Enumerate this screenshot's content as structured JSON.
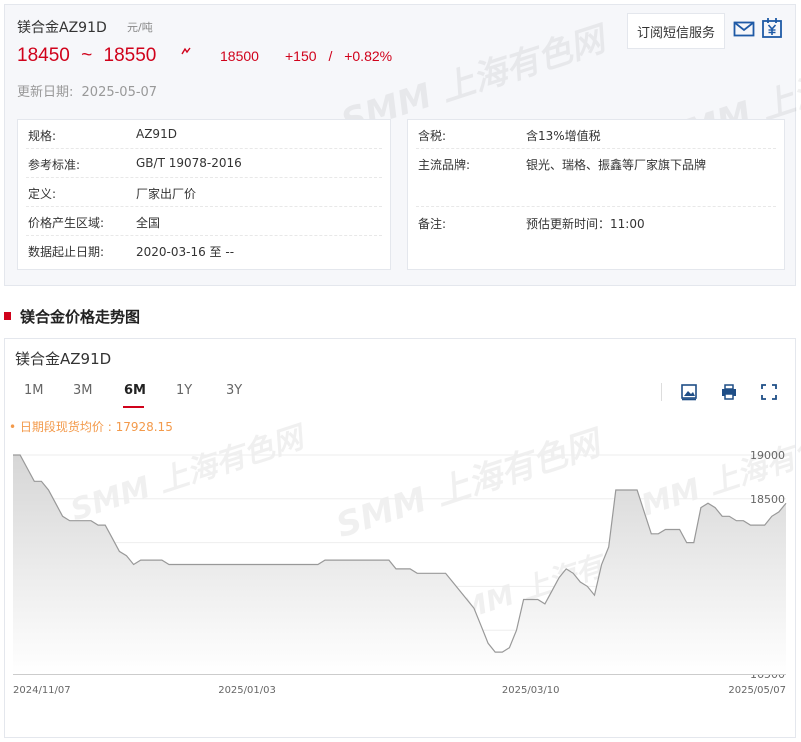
{
  "product": {
    "name": "镁合金AZ91D",
    "unit": "元/吨",
    "price_low": "18450",
    "price_tilde": "~",
    "price_high": "18550",
    "avg": "18500",
    "change": "+150",
    "change_sep": "/",
    "change_pct": "+0.82%",
    "update_label": "更新日期:",
    "update_date": "2025-05-07",
    "subscribe_label": "订阅短信服务"
  },
  "icons": {
    "mail": "mail-icon",
    "price": "yuan-calendar-icon",
    "trend": "trend-up-icon"
  },
  "info_left": [
    {
      "k": "规格:",
      "v": "AZ91D"
    },
    {
      "k": "参考标准:",
      "v": "GB/T 19078-2016"
    },
    {
      "k": "定义:",
      "v": "厂家出厂价"
    },
    {
      "k": "价格产生区域:",
      "v": "全国"
    },
    {
      "k": "数据起止日期:",
      "v": "2020-03-16 至 --"
    }
  ],
  "info_right": [
    {
      "k": "含税:",
      "v": "含13%增值税"
    },
    {
      "k": "主流品牌:",
      "v": "银光、瑞格、振鑫等厂家旗下品牌"
    },
    {
      "k": "备注:",
      "v": "预估更新时间：11:00"
    }
  ],
  "section": {
    "title": "镁合金价格走势图"
  },
  "chart": {
    "title": "镁合金AZ91D",
    "tabs": [
      "1M",
      "3M",
      "6M",
      "1Y",
      "3Y"
    ],
    "active_tab": "6M",
    "avg_note": "• 日期段现货均价 : 17928.15",
    "tools": [
      "download-image-icon",
      "print-icon",
      "fullscreen-icon"
    ],
    "watermark": "SMM 上海有色网"
  },
  "colors": {
    "accent": "#d0021b",
    "line": "#999999",
    "avg_note": "#f39a4b"
  },
  "chart_data": {
    "type": "area",
    "x_ticks": [
      "2024/11/07",
      "2025/01/03",
      "2025/03/10",
      "2025/05/07"
    ],
    "y_ticks": [
      16500,
      17000,
      17500,
      18000,
      18500,
      19000
    ],
    "ylim": [
      16500,
      19000
    ],
    "y_axis_position": "right",
    "grid": "horizontal",
    "series": [
      {
        "values": [
          19000,
          19000,
          18850,
          18700,
          18700,
          18600,
          18450,
          18300,
          18250,
          18250,
          18250,
          18250,
          18200,
          18200,
          18050,
          17900,
          17850,
          17750,
          17800,
          17800,
          17800,
          17800,
          17750,
          17750,
          17750,
          17750,
          17750,
          17750,
          17750,
          17750,
          17750,
          17750,
          17750,
          17750,
          17750,
          17750,
          17750,
          17750,
          17750,
          17750,
          17750,
          17750,
          17750,
          17750,
          17800,
          17800,
          17800,
          17800,
          17800,
          17800,
          17800,
          17800,
          17800,
          17800,
          17700,
          17700,
          17700,
          17650,
          17650,
          17650,
          17650,
          17650,
          17550,
          17450,
          17350,
          17250,
          17050,
          16850,
          16750,
          16750,
          16800,
          17000,
          17350,
          17350,
          17350,
          17300,
          17450,
          17600,
          17700,
          17650,
          17550,
          17500,
          17400,
          17750,
          17950,
          18600,
          18600,
          18600,
          18600,
          18350,
          18100,
          18100,
          18150,
          18150,
          18150,
          18000,
          18000,
          18400,
          18450,
          18400,
          18300,
          18300,
          18250,
          18250,
          18200,
          18200,
          18200,
          18300,
          18350,
          18450
        ]
      }
    ]
  }
}
